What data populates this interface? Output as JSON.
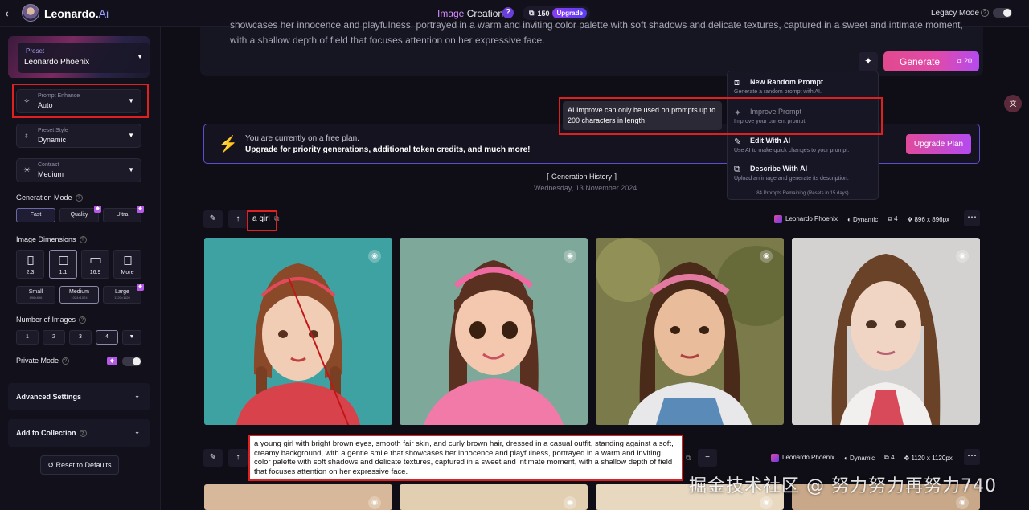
{
  "topbar": {
    "app_name_main": "Leonardo.",
    "app_name_suffix": "Ai",
    "center_title_part1": "Image",
    "center_title_part2": " Creation",
    "tokens": "150",
    "upgrade_label": "Upgrade",
    "legacy_mode_label": "Legacy Mode"
  },
  "sidebar": {
    "preset": {
      "label": "Preset",
      "value": "Leonardo Phoenix"
    },
    "prompt_enhance": {
      "label": "Prompt Enhance",
      "value": "Auto"
    },
    "preset_style": {
      "label": "Preset Style",
      "value": "Dynamic"
    },
    "contrast": {
      "label": "Contrast",
      "value": "Medium"
    },
    "generation_mode": {
      "title": "Generation Mode",
      "options": [
        "Fast",
        "Quality",
        "Ultra"
      ],
      "selected": "Fast"
    },
    "image_dimensions": {
      "title": "Image Dimensions",
      "ratios": [
        "2:3",
        "1:1",
        "16:9",
        "More"
      ],
      "selected_ratio": "1:1",
      "sizes": [
        {
          "label": "Small",
          "px": "896×896"
        },
        {
          "label": "Medium",
          "px": "1024×1024"
        },
        {
          "label": "Large",
          "px": "1120×1120"
        }
      ],
      "selected_size": "Medium"
    },
    "number_of_images": {
      "title": "Number of Images",
      "options": [
        "1",
        "2",
        "3",
        "4"
      ],
      "selected": "4"
    },
    "private_mode_label": "Private Mode",
    "advanced_settings_label": "Advanced Settings",
    "add_to_collection_label": "Add to Collection",
    "reset_label": "Reset to Defaults"
  },
  "prompt": {
    "text": "showcases her innocence and playfulness, portrayed in a warm and inviting color palette with soft shadows and delicate textures, captured in a sweet and intimate moment, with a shallow depth of field that focuses attention on her expressive face.",
    "generate_label": "Generate",
    "generate_cost": "20"
  },
  "menu": {
    "items": [
      {
        "title": "New Random Prompt",
        "desc": "Generate a random prompt with AI."
      },
      {
        "title": "Improve Prompt",
        "desc": "Improve your current prompt."
      },
      {
        "title": "Edit With AI",
        "desc": "Use AI to make quick changes to your prompt."
      },
      {
        "title": "Describe With AI",
        "desc": "Upload an image and generate its description."
      }
    ],
    "footer": "84 Prompts Remaining (Resets in 15 days)",
    "tooltip": "AI Improve can only be used on prompts up to 200 characters in length"
  },
  "banner": {
    "line1": "You are currently on a free plan.",
    "line2": "Upgrade for priority generations, additional token credits, and much more!",
    "button": "Upgrade Plan"
  },
  "history": {
    "title": "Generation History",
    "date": "Wednesday, 13 November 2024"
  },
  "generations": [
    {
      "prompt": "a girl",
      "model": "Leonardo Phoenix",
      "style": "Dynamic",
      "count": "4",
      "size": "896 x 896px"
    },
    {
      "prompt": "a young girl with bright brown eyes, smooth fair skin, and curly brown hair, dressed in a casual outfit, standing against a soft, creamy background, with a gentle smile that showcases her innocence and playfulness, portrayed in a warm and inviting color palette with soft shadows and delicate textures, captured in a sweet and intimate moment, with a shallow depth of field that focuses attention on her expressive face.",
      "model": "Leonardo Phoenix",
      "style": "Dynamic",
      "count": "4",
      "size": "1120 x 1120px"
    }
  ],
  "watermark": "掘金技术社区 @ 努力努力再努力740"
}
